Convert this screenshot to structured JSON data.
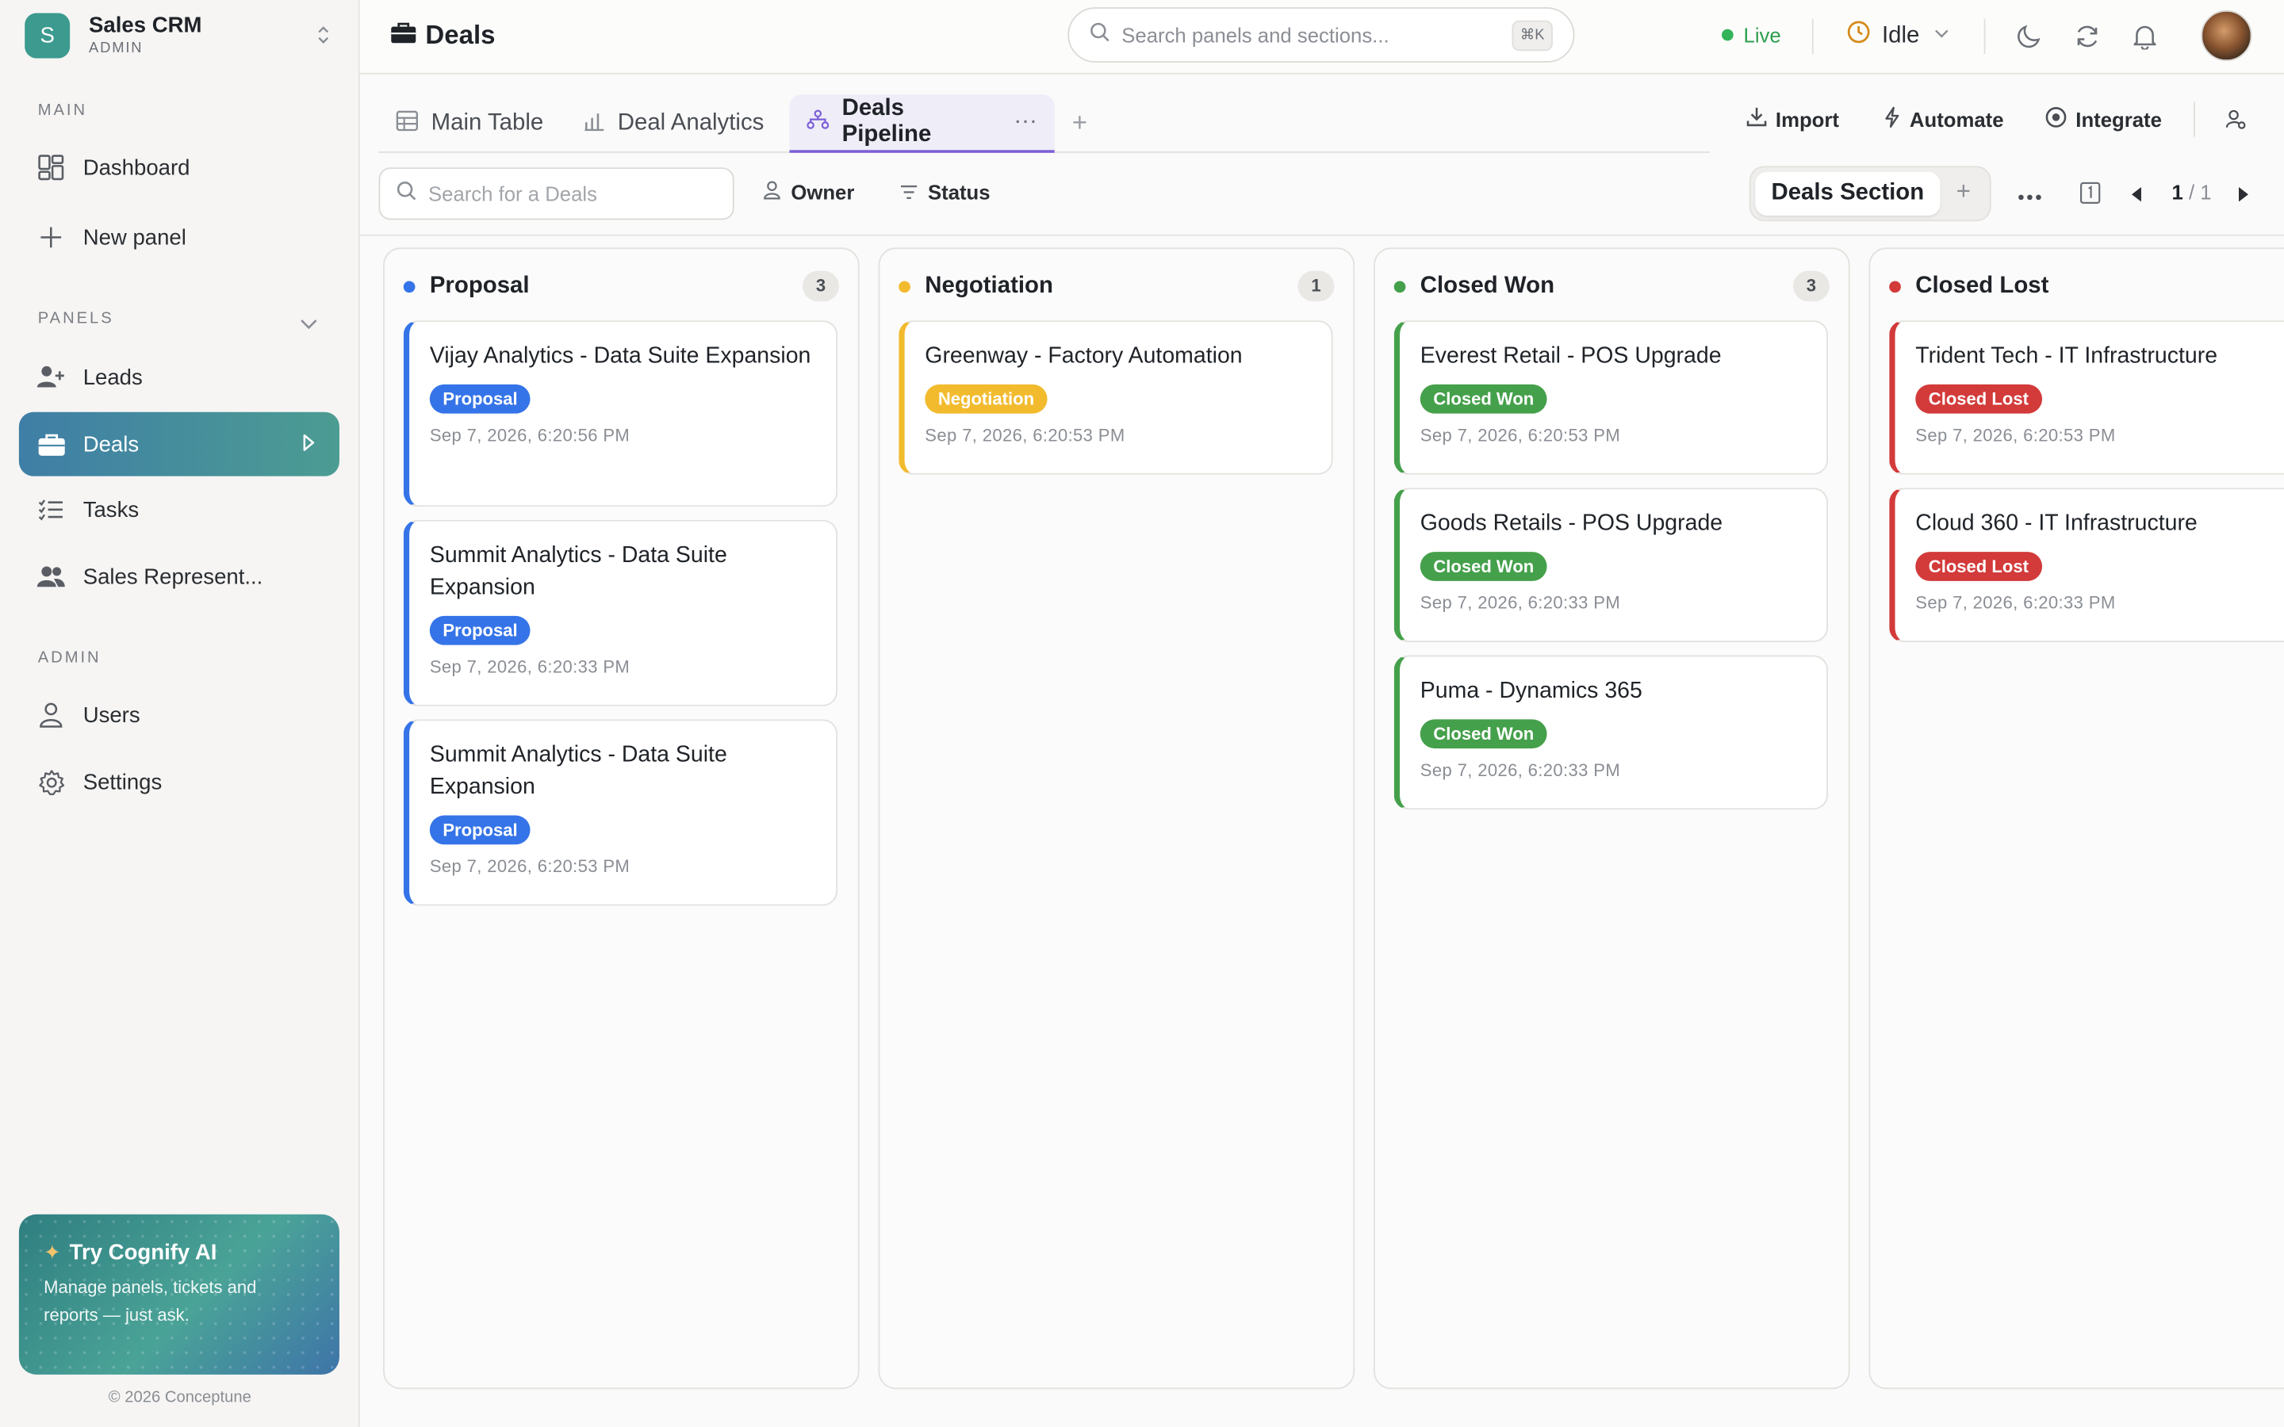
{
  "brand": {
    "initial": "S",
    "name": "Sales CRM",
    "role": "ADMIN"
  },
  "sidebar": {
    "main_label": "MAIN",
    "main_items": [
      {
        "label": "Dashboard",
        "icon": "grid-icon"
      },
      {
        "label": "New panel",
        "icon": "plus-icon"
      }
    ],
    "panels_label": "PANELS",
    "panel_items": [
      {
        "label": "Leads",
        "icon": "user-plus-icon"
      },
      {
        "label": "Deals",
        "icon": "briefcase-icon",
        "active": true
      },
      {
        "label": "Tasks",
        "icon": "list-check-icon"
      },
      {
        "label": "Sales Represent...",
        "icon": "users-icon"
      }
    ],
    "admin_label": "ADMIN",
    "admin_items": [
      {
        "label": "Users",
        "icon": "user-icon"
      },
      {
        "label": "Settings",
        "icon": "gear-icon"
      }
    ],
    "promo": {
      "title": "Try Cognify AI",
      "body": "Manage panels, tickets and reports — just ask."
    },
    "copyright": "© 2026 Conceptune"
  },
  "topbar": {
    "title": "Deals",
    "search_placeholder": "Search panels and sections...",
    "search_shortcut": "⌘K",
    "live_label": "Live",
    "status_label": "Idle"
  },
  "tabs": [
    {
      "label": "Main Table",
      "icon": "table-icon"
    },
    {
      "label": "Deal Analytics",
      "icon": "bar-chart-icon"
    },
    {
      "label": "Deals Pipeline",
      "icon": "pipeline-icon",
      "active": true
    }
  ],
  "actions": {
    "import": "Import",
    "automate": "Automate",
    "integrate": "Integrate"
  },
  "toolbar": {
    "search_placeholder": "Search for a Deals",
    "owner_filter": "Owner",
    "status_filter": "Status",
    "section_label": "Deals Section",
    "page_current": "1",
    "page_total": "/ 1"
  },
  "colors": {
    "proposal": "#3574e8",
    "negotiation": "#f2bb2e",
    "closed_won": "#45a04b",
    "closed_lost": "#d33a3a",
    "accent": "#7c5fd8"
  },
  "columns": [
    {
      "title": "Proposal",
      "count": "3",
      "color": "#3574e8",
      "cards": [
        {
          "title": "Vijay Analytics - Data Suite Expansion",
          "badge": "Proposal",
          "date": "Sep 7, 2026, 6:20:56 PM"
        },
        {
          "title": "Summit Analytics - Data Suite Expansion",
          "badge": "Proposal",
          "date": "Sep 7, 2026, 6:20:33 PM"
        },
        {
          "title": "Summit Analytics - Data Suite Expansion",
          "badge": "Proposal",
          "date": "Sep 7, 2026, 6:20:53 PM"
        }
      ]
    },
    {
      "title": "Negotiation",
      "count": "1",
      "color": "#f2bb2e",
      "cards": [
        {
          "title": "Greenway - Factory Automation",
          "badge": "Negotiation",
          "date": "Sep 7, 2026, 6:20:53 PM"
        }
      ]
    },
    {
      "title": "Closed Won",
      "count": "3",
      "color": "#45a04b",
      "cards": [
        {
          "title": "Everest Retail - POS Upgrade",
          "badge": "Closed Won",
          "date": "Sep 7, 2026, 6:20:53 PM"
        },
        {
          "title": "Goods Retails - POS Upgrade",
          "badge": "Closed Won",
          "date": "Sep 7, 2026, 6:20:33 PM"
        },
        {
          "title": "Puma - Dynamics 365",
          "badge": "Closed Won",
          "date": "Sep 7, 2026, 6:20:33 PM"
        }
      ]
    },
    {
      "title": "Closed Lost",
      "count": "",
      "color": "#d33a3a",
      "cards": [
        {
          "title": "Trident Tech - IT Infrastructure",
          "badge": "Closed Lost",
          "date": "Sep 7, 2026, 6:20:53 PM"
        },
        {
          "title": "Cloud 360 - IT Infrastructure",
          "badge": "Closed Lost",
          "date": "Sep 7, 2026, 6:20:33 PM"
        }
      ]
    }
  ]
}
